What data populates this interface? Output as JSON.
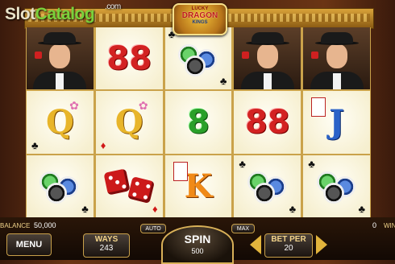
{
  "watermark": {
    "slot": "Slot",
    "catalog": "Catalog",
    "com": ".com"
  },
  "logo": {
    "line1": "LUCKY",
    "line2": "DRAGON",
    "line3": "KINGS"
  },
  "reels": [
    {
      "symbols": [
        "man-with-hat",
        "Q",
        "chips"
      ]
    },
    {
      "symbols": [
        "88",
        "Q",
        "dice"
      ]
    },
    {
      "symbols": [
        "chips",
        "8",
        "K"
      ]
    },
    {
      "symbols": [
        "man-with-hat",
        "88",
        "chips"
      ]
    },
    {
      "symbols": [
        "man-with-hat",
        "J",
        "chips"
      ]
    }
  ],
  "text_symbols": {
    "r2_top": "88",
    "r3_mid": "8",
    "r4_mid": "88",
    "q1": "Q",
    "q2": "Q",
    "k": "K",
    "j": "J"
  },
  "suits": {
    "club": "♣",
    "diamond": "♦"
  },
  "status": {
    "balance_label": "BALANCE",
    "balance_value": "50,000",
    "win_label": "WIN",
    "win_value": "0"
  },
  "controls": {
    "menu_label": "MENU",
    "ways_label": "WAYS",
    "ways_value": "243",
    "auto_label": "AUTO",
    "spin_label": "SPIN",
    "spin_value": "500",
    "max_label": "MAX",
    "betper_label": "BET PER",
    "betper_value": "20"
  },
  "colors": {
    "accent_gold": "#e2b43c",
    "red": "#d32222",
    "green": "#2aa02a",
    "blue": "#2a62c8"
  }
}
